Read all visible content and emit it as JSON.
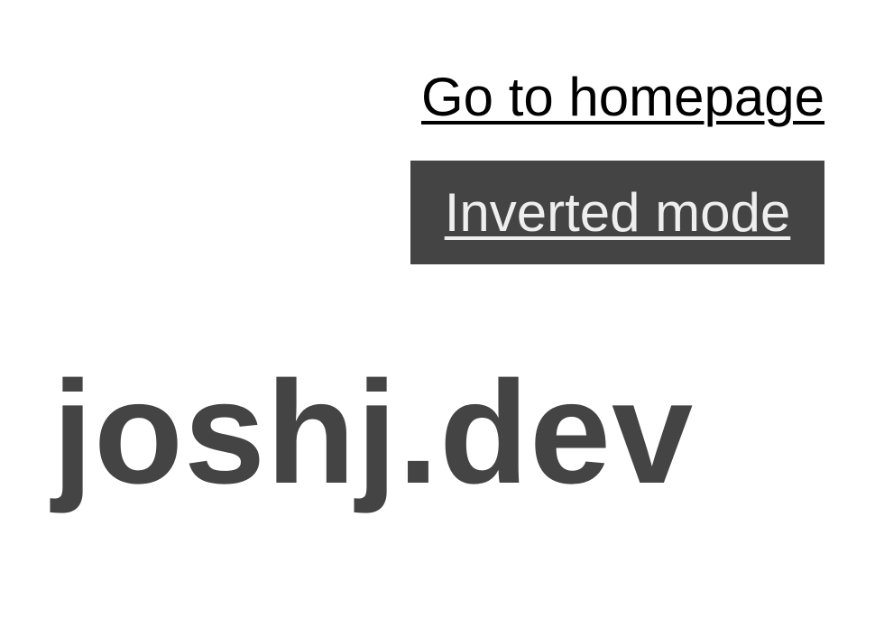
{
  "nav": {
    "home_link": "Go to homepage",
    "invert_button": "Inverted mode"
  },
  "header": {
    "site_title": "joshj.dev"
  },
  "colors": {
    "text_dark": "#444444",
    "link": "#000000",
    "button_bg": "#444444",
    "button_text": "#eeeeee",
    "background": "#ffffff"
  }
}
